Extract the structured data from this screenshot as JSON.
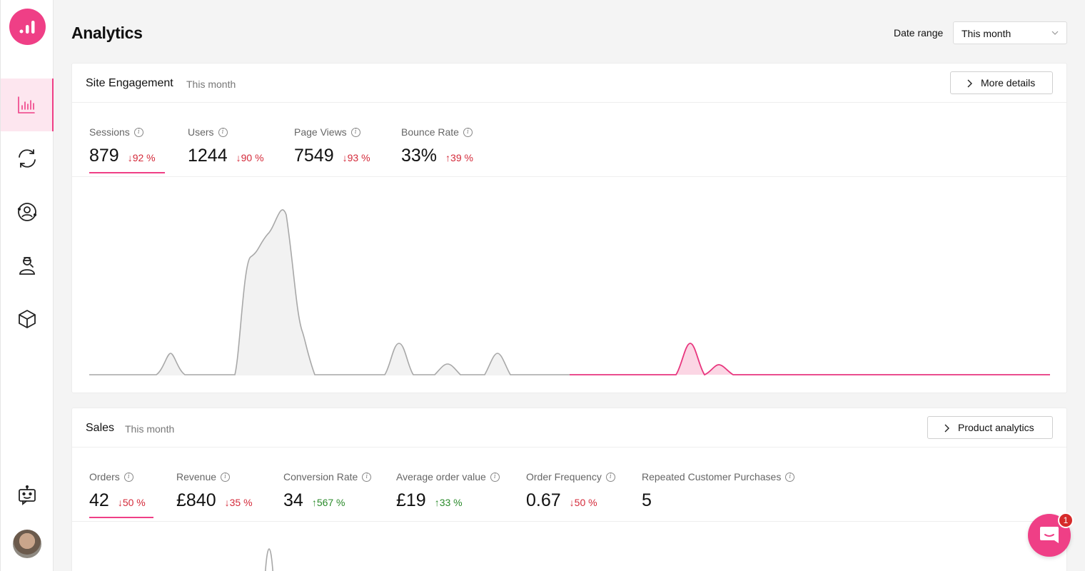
{
  "page": {
    "title": "Analytics"
  },
  "date_range": {
    "label": "Date range",
    "value": "This month"
  },
  "sidebar": {
    "items": [
      {
        "name": "analytics",
        "icon": "bar-chart-icon",
        "active": true
      },
      {
        "name": "sync",
        "icon": "refresh-icon",
        "active": false
      },
      {
        "name": "customers",
        "icon": "user-circle-icon",
        "active": false
      },
      {
        "name": "agent",
        "icon": "support-agent-icon",
        "active": false
      },
      {
        "name": "products",
        "icon": "cube-icon",
        "active": false
      }
    ],
    "bot_icon": "bot-icon"
  },
  "engagement": {
    "title": "Site Engagement",
    "subtitle": "This month",
    "button": "More details",
    "metrics": [
      {
        "label": "Sessions",
        "value": "879",
        "delta": "92 %",
        "direction": "down",
        "selected": true
      },
      {
        "label": "Users",
        "value": "1244",
        "delta": "90 %",
        "direction": "down"
      },
      {
        "label": "Page Views",
        "value": "7549",
        "delta": "93 %",
        "direction": "down"
      },
      {
        "label": "Bounce Rate",
        "value": "33%",
        "delta": "39 %",
        "direction": "up_bad"
      }
    ]
  },
  "sales": {
    "title": "Sales",
    "subtitle": "This month",
    "button": "Product analytics",
    "metrics": [
      {
        "label": "Orders",
        "value": "42",
        "delta": "50 %",
        "direction": "down",
        "selected": true
      },
      {
        "label": "Revenue",
        "value": "£840",
        "delta": "35 %",
        "direction": "down"
      },
      {
        "label": "Conversion Rate",
        "value": "34",
        "delta": "567 %",
        "direction": "up"
      },
      {
        "label": "Average order value",
        "value": "£19",
        "delta": "33 %",
        "direction": "up"
      },
      {
        "label": "Order Frequency",
        "value": "0.67",
        "delta": "50 %",
        "direction": "down"
      },
      {
        "label": "Repeated Customer Purchases",
        "value": "5",
        "delta": ""
      }
    ]
  },
  "chat": {
    "badge_count": "1"
  },
  "colors": {
    "accent": "#ef3f86",
    "down": "#d42a3a",
    "up": "#2a8a2a",
    "previous_period": "#a8a8a8"
  }
}
